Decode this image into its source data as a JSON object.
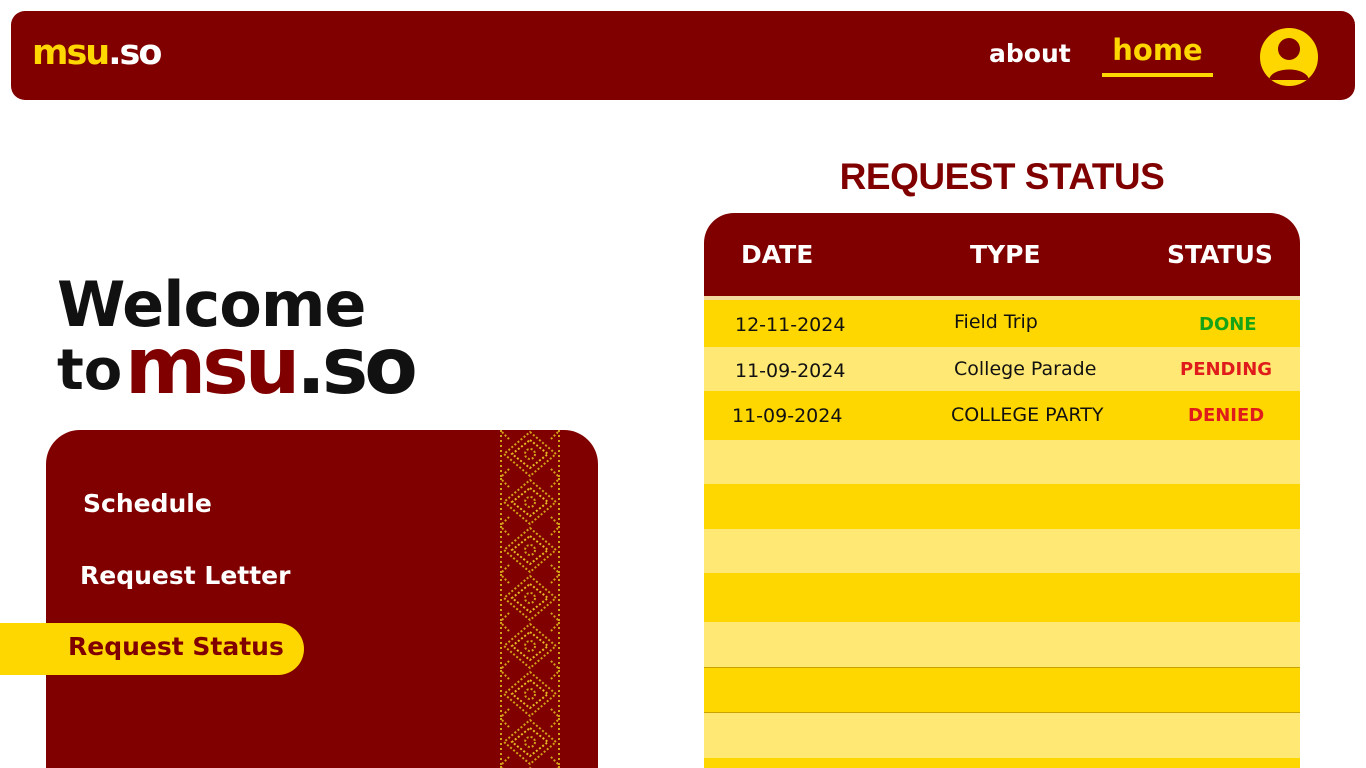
{
  "navbar": {
    "logo_part1": "msu",
    "logo_part2": ".so",
    "links": {
      "about": "about",
      "home": "home"
    },
    "avatar_icon": "user-avatar-icon"
  },
  "welcome": {
    "line1": "Welcome",
    "to": "to",
    "brand_part1": "msu",
    "brand_part2": ".so"
  },
  "menu": {
    "schedule": "Schedule",
    "request_letter": "Request Letter",
    "request_status": "Request Status"
  },
  "status_page": {
    "title": "REQUEST STATUS",
    "columns": {
      "date": "DATE",
      "type": "TYPE",
      "status": "STATUS"
    },
    "rows": [
      {
        "date": "12-11-2024",
        "type": "Field Trip",
        "status": "DONE"
      },
      {
        "date": "11-09-2024",
        "type": "College Parade",
        "status": "PENDING"
      },
      {
        "date": "11-09-2024",
        "type": "COLLEGE PARTY",
        "status": "DENIED"
      }
    ]
  },
  "colors": {
    "maroon": "#800000",
    "gold": "#ffd700",
    "light_gold": "#ffe873",
    "done": "#16a316",
    "pending": "#e01b1b",
    "denied": "#e01b1b"
  }
}
